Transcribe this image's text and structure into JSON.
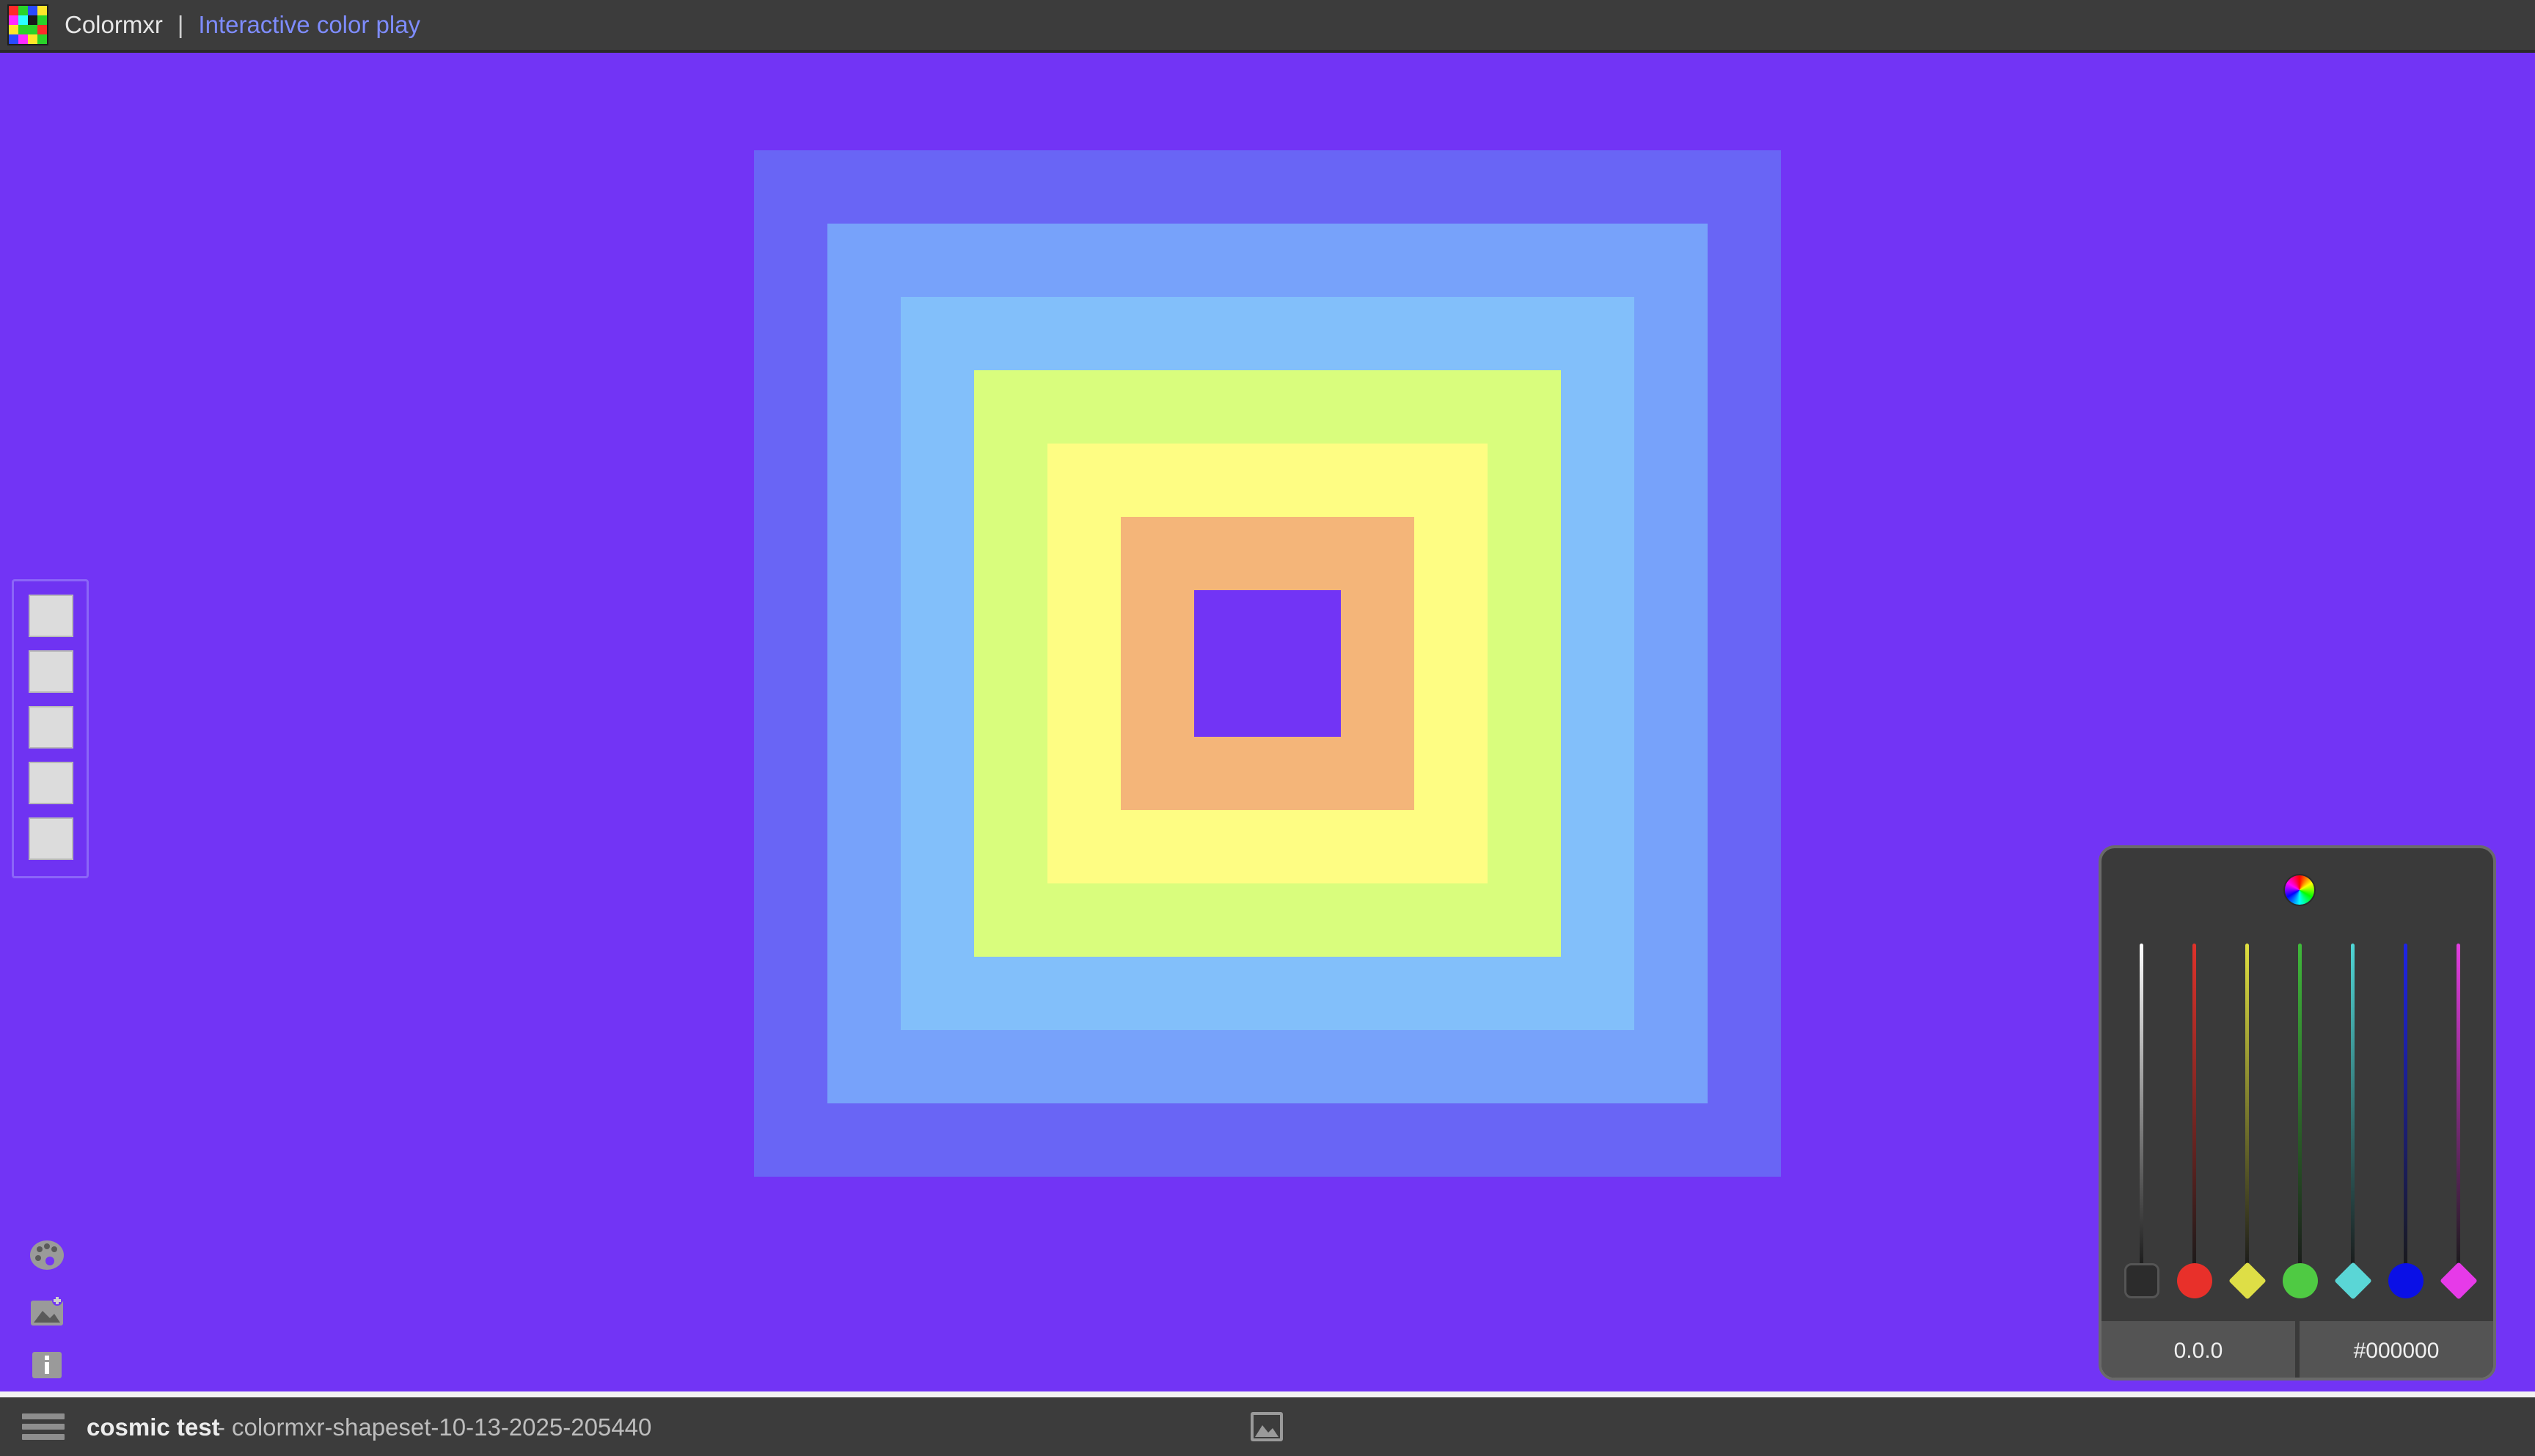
{
  "header": {
    "app_title": "Colormxr",
    "separator": "|",
    "subtitle": "Interactive color play",
    "logo_icon": "pixel-grid-logo-icon"
  },
  "colors": {
    "background": "#7234f5",
    "rings": [
      "#6965f5",
      "#77a2fa",
      "#82bffa",
      "#d9fd7d",
      "#fefd83",
      "#f4b579",
      "#7234f5"
    ]
  },
  "shape_toolbar": {
    "slots": 5
  },
  "tools": {
    "icons": [
      "palette-icon",
      "add-image-icon",
      "info-icon"
    ]
  },
  "mixer": {
    "wheel_icon": "color-wheel-icon",
    "channels": [
      {
        "name": "white",
        "color": "#ffffff",
        "thumb": "square",
        "thumb_color": "#2c2c2c"
      },
      {
        "name": "red",
        "color": "#e0322a",
        "thumb": "circle",
        "thumb_color": "#e8302a"
      },
      {
        "name": "yellow",
        "color": "#e0e040",
        "thumb": "diamond",
        "thumb_color": "#dede46"
      },
      {
        "name": "green",
        "color": "#3fba3a",
        "thumb": "circle",
        "thumb_color": "#4fca43"
      },
      {
        "name": "cyan",
        "color": "#4fd6d6",
        "thumb": "diamond",
        "thumb_color": "#5ad6d6"
      },
      {
        "name": "blue",
        "color": "#1e24e8",
        "thumb": "circle",
        "thumb_color": "#0a10e6"
      },
      {
        "name": "magenta",
        "color": "#e33ee0",
        "thumb": "diamond",
        "thumb_color": "#e63ae8"
      }
    ],
    "value_left": "0.0.0",
    "value_right": "#000000"
  },
  "statusbar": {
    "menu_icon": "hamburger-menu-icon",
    "project_name": "cosmic test",
    "separator": "-",
    "file_name": "colormxr-shapeset-10-13-2025-205440",
    "gallery_icon": "gallery-icon"
  }
}
